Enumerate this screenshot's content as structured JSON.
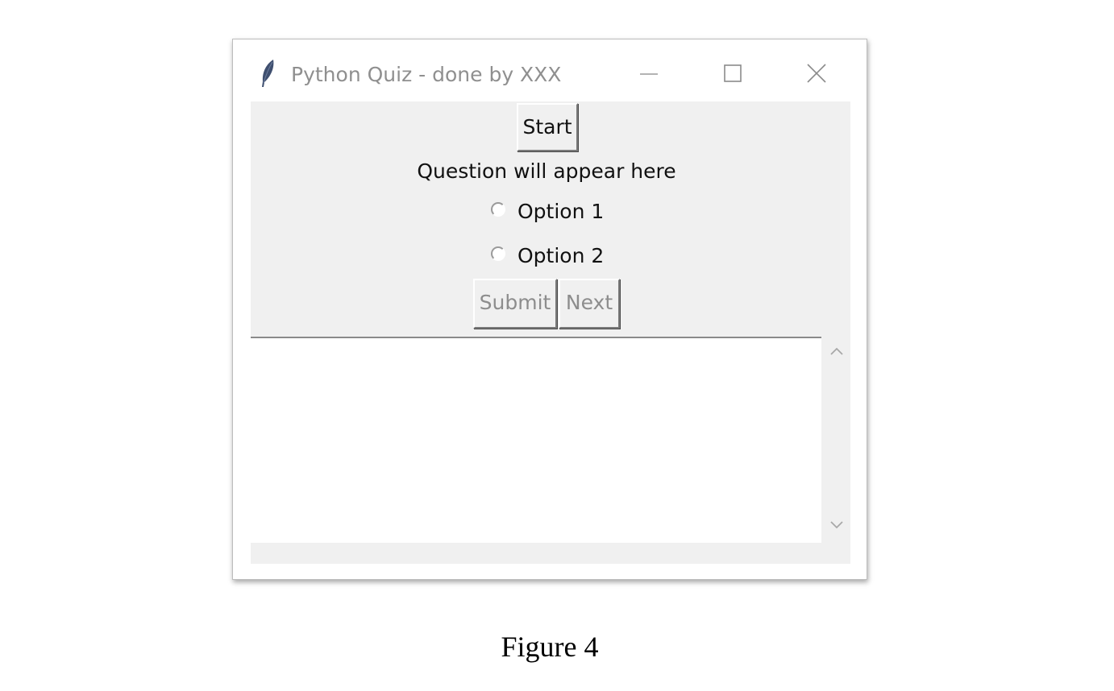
{
  "window": {
    "title": "Python Quiz - done by XXX",
    "icons": {
      "app": "feather-icon",
      "minimize": "minimize-icon",
      "maximize": "maximize-icon",
      "close": "close-icon"
    }
  },
  "quiz": {
    "start_label": "Start",
    "question_text": "Question will appear here",
    "options": [
      {
        "label": "Option 1",
        "selected": false
      },
      {
        "label": "Option 2",
        "selected": false
      }
    ],
    "submit_label": "Submit",
    "submit_enabled": false,
    "next_label": "Next",
    "next_enabled": false
  },
  "output_text": "",
  "caption": "Figure 4"
}
